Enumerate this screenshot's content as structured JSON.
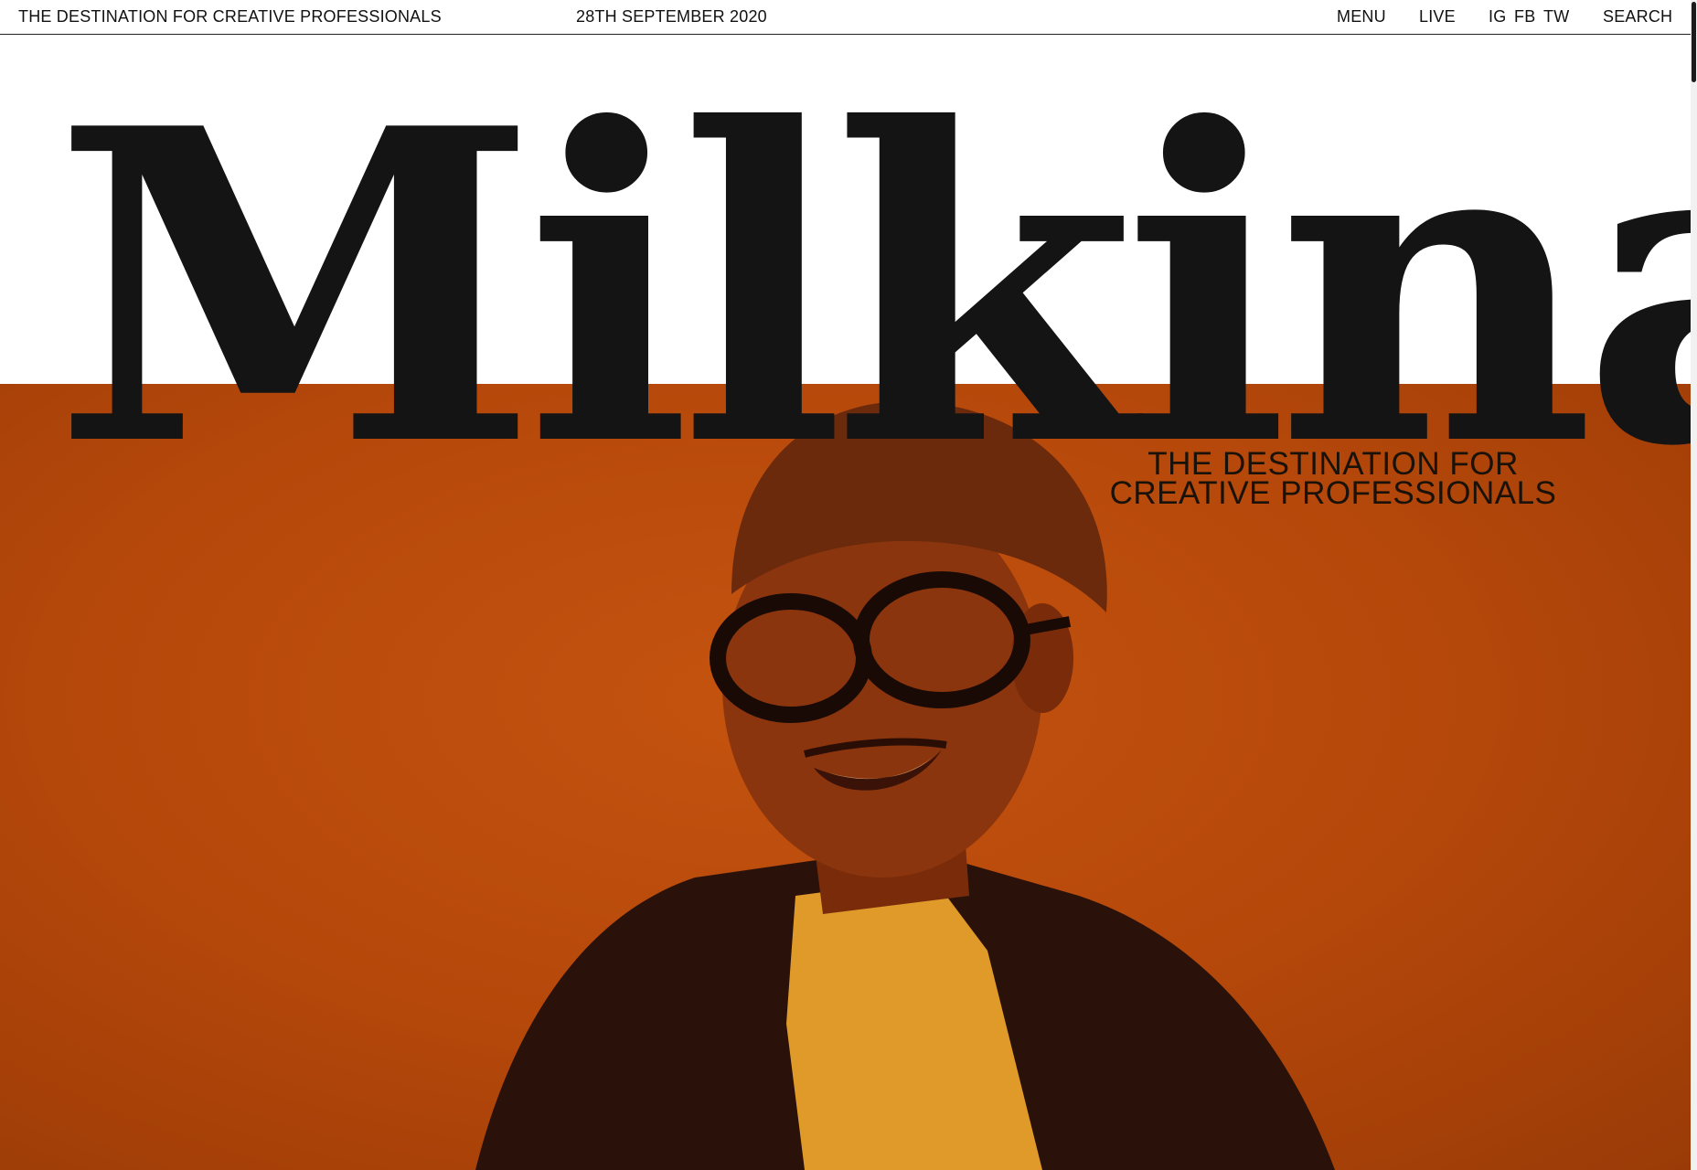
{
  "header": {
    "tagline": "THE DESTINATION FOR CREATIVE PROFESSIONALS",
    "date": "28TH SEPTEMBER 2020",
    "nav": {
      "menu": "MENU",
      "live": "LIVE",
      "instagram": "IG",
      "facebook": "FB",
      "twitter": "TW",
      "search": "SEARCH"
    }
  },
  "masthead": {
    "logo": "Milkina",
    "strapline_line1": "THE DESTINATION FOR",
    "strapline_line2": "CREATIVE PROFESSIONALS"
  },
  "colors": {
    "background": "#ffffff",
    "text": "#111111",
    "hero_orange": "#b4470a"
  },
  "hero": {
    "image": "portrait-of-smiling-man-in-beanie-and-glasses"
  }
}
